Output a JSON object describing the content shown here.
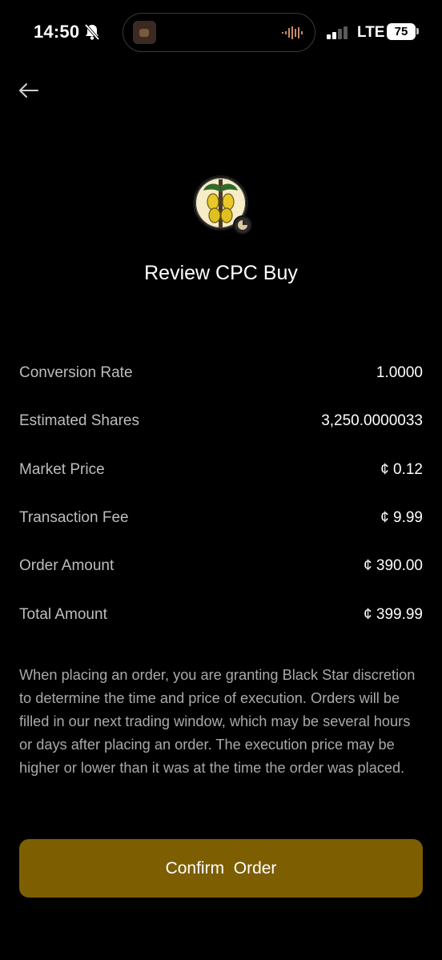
{
  "status_bar": {
    "time": "14:50",
    "network": "LTE",
    "battery": "75",
    "icons": [
      "bell-slash-icon",
      "audio-wave-icon",
      "signal-bars-icon",
      "battery-icon"
    ]
  },
  "header": {
    "back_icon": "arrow-left-icon"
  },
  "asset": {
    "logo_icon": "cocoa-pod-logo",
    "badge_icon": "pie-chart-badge-icon"
  },
  "title": "Review CPC Buy",
  "details": [
    {
      "label": "Conversion Rate",
      "value": "1.0000"
    },
    {
      "label": "Estimated Shares",
      "value": "3,250.0000033"
    },
    {
      "label": "Market Price",
      "value": "¢ 0.12"
    },
    {
      "label": "Transaction Fee",
      "value": "¢ 9.99"
    },
    {
      "label": "Order Amount",
      "value": "¢ 390.00"
    },
    {
      "label": "Total Amount",
      "value": "¢ 399.99"
    }
  ],
  "disclaimer": "When placing an order, you are granting Black Star discretion to determine the time and price of execution. Orders will be filled in our next trading window, which may be several hours or days after placing an order. The execution price may be higher or lower than it was at the time the order was placed.",
  "confirm_label": "Confirm  Order",
  "colors": {
    "background": "#000000",
    "accent": "#7d5e00",
    "label": "#bdbdbd",
    "disclaimer": "#a9a9a9"
  }
}
